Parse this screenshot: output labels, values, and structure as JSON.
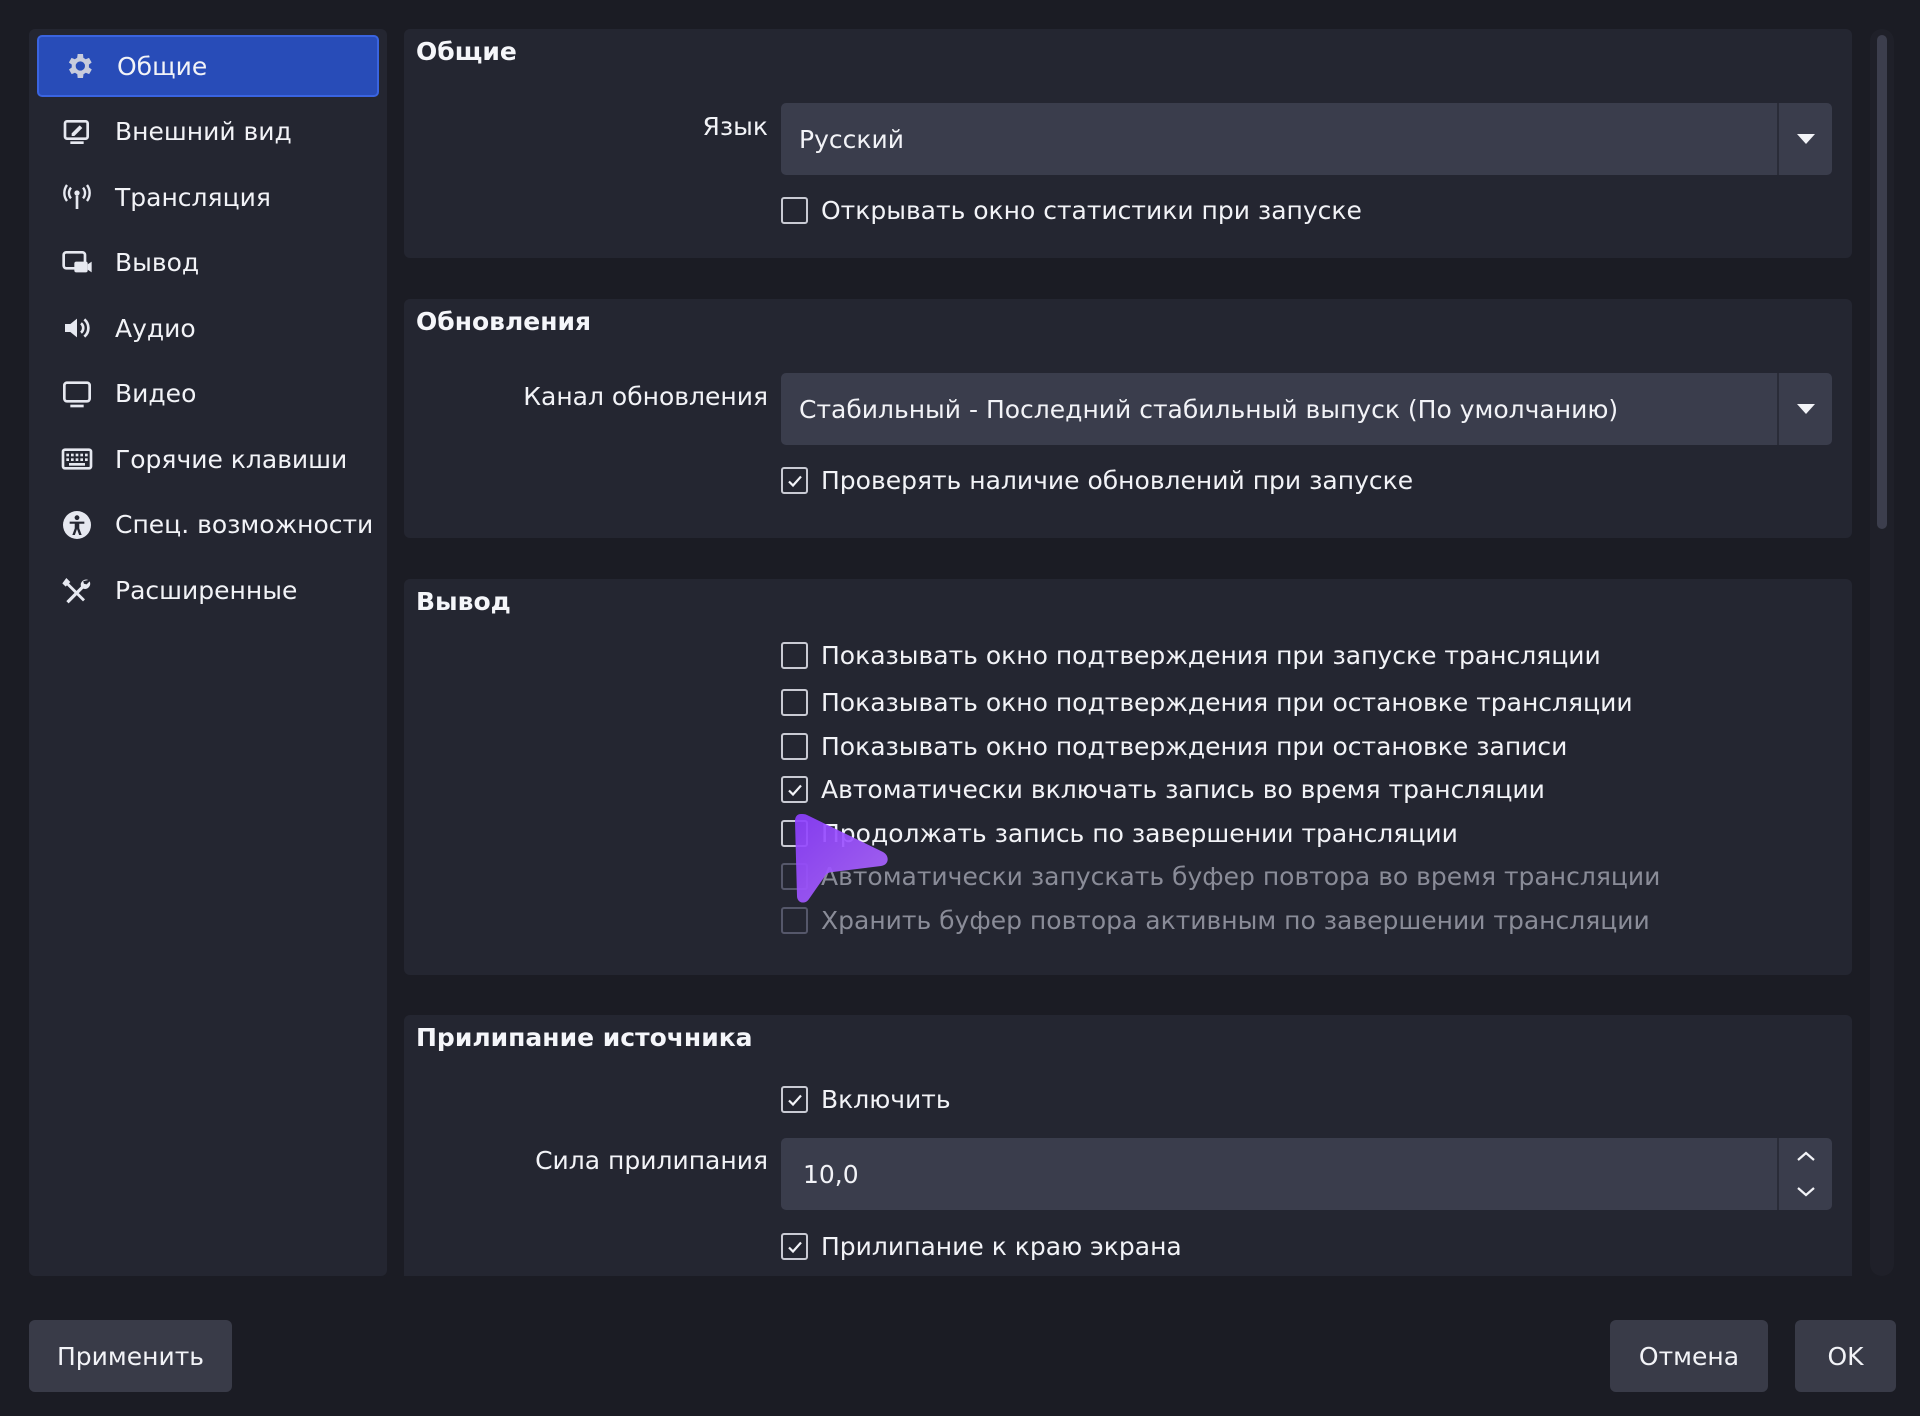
{
  "sidebar": {
    "items": [
      {
        "label": "Общие",
        "icon": "gear-icon",
        "active": true
      },
      {
        "label": "Внешний вид",
        "icon": "appearance-icon",
        "active": false
      },
      {
        "label": "Трансляция",
        "icon": "broadcast-icon",
        "active": false
      },
      {
        "label": "Вывод",
        "icon": "output-icon",
        "active": false
      },
      {
        "label": "Аудио",
        "icon": "speaker-icon",
        "active": false
      },
      {
        "label": "Видео",
        "icon": "monitor-icon",
        "active": false
      },
      {
        "label": "Горячие клавиши",
        "icon": "keyboard-icon",
        "active": false
      },
      {
        "label": "Спец. возможности",
        "icon": "accessibility-icon",
        "active": false
      },
      {
        "label": "Расширенные",
        "icon": "tools-icon",
        "active": false
      }
    ]
  },
  "general": {
    "title": "Общие",
    "language_label": "Язык",
    "language_value": "Русский",
    "stats_on_start": {
      "label": "Открывать окно статистики при запуске",
      "checked": false
    }
  },
  "updates": {
    "title": "Обновления",
    "channel_label": "Канал обновления",
    "channel_value": "Стабильный - Последний стабильный выпуск (По умолчанию)",
    "check_on_start": {
      "label": "Проверять наличие обновлений при запуске",
      "checked": true
    }
  },
  "output": {
    "title": "Вывод",
    "options": [
      {
        "label": "Показывать окно подтверждения при запуске трансляции",
        "checked": false,
        "disabled": false
      },
      {
        "label": "Показывать окно подтверждения при остановке трансляции",
        "checked": false,
        "disabled": false
      },
      {
        "label": "Показывать окно подтверждения при остановке записи",
        "checked": false,
        "disabled": false
      },
      {
        "label": "Автоматически включать запись во время трансляции",
        "checked": true,
        "disabled": false
      },
      {
        "label": "Продолжать запись по завершении трансляции",
        "checked": false,
        "disabled": false
      },
      {
        "label": "Автоматически запускать буфер повтора во время трансляции",
        "checked": false,
        "disabled": true
      },
      {
        "label": "Хранить буфер повтора активным по завершении трансляции",
        "checked": false,
        "disabled": true
      }
    ]
  },
  "snapping": {
    "title": "Прилипание источника",
    "enable": {
      "label": "Включить",
      "checked": true
    },
    "strength_label": "Сила прилипания",
    "strength_value": "10,0",
    "screen_edge": {
      "label": "Прилипание к краю экрана",
      "checked": true
    }
  },
  "buttons": {
    "apply": "Применить",
    "cancel": "Отмена",
    "ok": "OK"
  },
  "colors": {
    "accent": "#284cb8",
    "cursor": "#9b4dff"
  }
}
